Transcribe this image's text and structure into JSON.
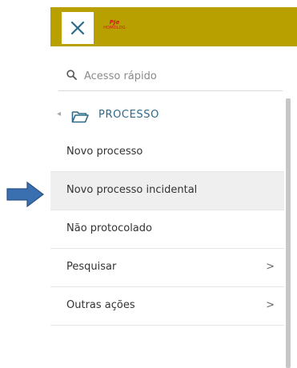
{
  "header": {
    "close_icon": "close-icon",
    "logo_line1": "PJe",
    "logo_line2": "HOMOLOG",
    "brand_color": "#b8a000"
  },
  "search": {
    "placeholder": "Acesso rápido",
    "value": ""
  },
  "section": {
    "title": "PROCESSO",
    "back_icon": "chevron-left-icon",
    "folder_icon": "folder-open-icon"
  },
  "items": [
    {
      "label": "Novo processo",
      "chevron": ""
    },
    {
      "label": "Novo processo incidental",
      "chevron": ""
    },
    {
      "label": "Não protocolado",
      "chevron": ""
    },
    {
      "label": "Pesquisar",
      "chevron": ">"
    },
    {
      "label": "Outras ações",
      "chevron": ">"
    }
  ],
  "annotation": {
    "arrow_color": "#3a6fb0",
    "points_to": "Novo processo incidental"
  }
}
